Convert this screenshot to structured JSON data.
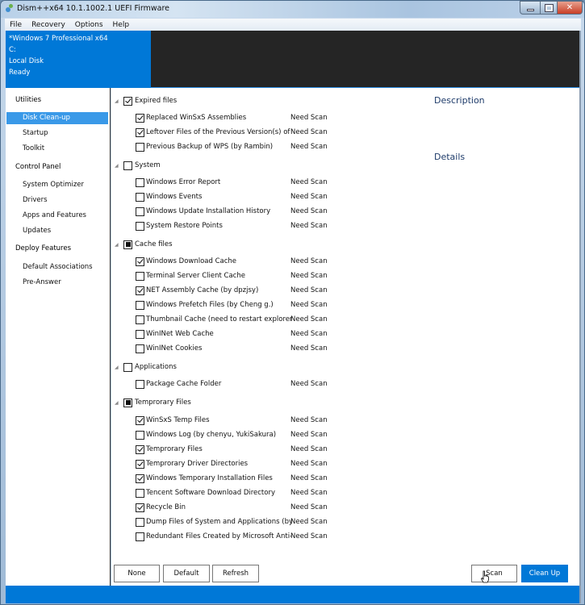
{
  "window": {
    "title": "Dism++x64 10.1.1002.1 UEFI Firmware",
    "controls": {
      "minimize": "minimize",
      "maximize": "maximize",
      "close": "close"
    }
  },
  "menu": [
    "File",
    "Recovery",
    "Options",
    "Help"
  ],
  "info": {
    "os": "*Windows 7 Professional x64",
    "drive": "C:",
    "disk": "Local Disk",
    "status": "Ready"
  },
  "sidebar": {
    "sections": [
      {
        "label": "Utilities",
        "items": [
          {
            "label": "Disk Clean-up",
            "selected": true
          },
          {
            "label": "Startup"
          },
          {
            "label": "Toolkit"
          }
        ]
      },
      {
        "label": "Control Panel",
        "items": [
          {
            "label": "System Optimizer"
          },
          {
            "label": "Drivers"
          },
          {
            "label": "Apps and Features"
          },
          {
            "label": "Updates"
          }
        ]
      },
      {
        "label": "Deploy Features",
        "items": [
          {
            "label": "Default Associations"
          },
          {
            "label": "Pre-Answer"
          }
        ]
      }
    ]
  },
  "tree": [
    {
      "label": "Expired files",
      "state": "checked",
      "items": [
        {
          "label": "Replaced WinSxS Assemblies",
          "checked": true,
          "status": "Need Scan"
        },
        {
          "label": "Leftover Files of the Previous Version(s) of Dism++",
          "checked": true,
          "status": "Need Scan"
        },
        {
          "label": "Previous Backup of WPS (by Rambin)",
          "checked": false,
          "status": "Need Scan"
        }
      ]
    },
    {
      "label": "System",
      "state": "unchecked",
      "items": [
        {
          "label": "Windows Error Report",
          "checked": false,
          "status": "Need Scan"
        },
        {
          "label": "Windows Events",
          "checked": false,
          "status": "Need Scan"
        },
        {
          "label": "Windows Update Installation History",
          "checked": false,
          "status": "Need Scan"
        },
        {
          "label": "System Restore Points",
          "checked": false,
          "status": "Need Scan"
        }
      ]
    },
    {
      "label": "Cache files",
      "state": "partial",
      "items": [
        {
          "label": "Windows Download Cache",
          "checked": true,
          "status": "Need Scan"
        },
        {
          "label": "Terminal Server Client Cache",
          "checked": false,
          "status": "Need Scan"
        },
        {
          "label": "NET Assembly Cache (by dpzjsy)",
          "checked": true,
          "status": "Need Scan"
        },
        {
          "label": "Windows Prefetch Files (by Cheng g.)",
          "checked": false,
          "status": "Need Scan"
        },
        {
          "label": "Thumbnail Cache (need to restart explorer)",
          "checked": false,
          "status": "Need Scan"
        },
        {
          "label": "WinINet Web Cache",
          "checked": false,
          "status": "Need Scan"
        },
        {
          "label": "WinINet Cookies",
          "checked": false,
          "status": "Need Scan"
        }
      ]
    },
    {
      "label": "Applications",
      "state": "unchecked",
      "items": [
        {
          "label": "Package Cache Folder",
          "checked": false,
          "status": "Need Scan"
        }
      ]
    },
    {
      "label": "Temprorary Files",
      "state": "partial",
      "items": [
        {
          "label": "WinSxS Temp Files",
          "checked": true,
          "status": "Need Scan"
        },
        {
          "label": "Windows Log (by chenyu, YukiSakura)",
          "checked": false,
          "status": "Need Scan"
        },
        {
          "label": "Temprorary Files",
          "checked": true,
          "status": "Need Scan"
        },
        {
          "label": "Temprorary Driver Directories",
          "checked": true,
          "status": "Need Scan"
        },
        {
          "label": "Windows Temporary Installation Files",
          "checked": true,
          "status": "Need Scan"
        },
        {
          "label": "Tencent Software Download Directory",
          "checked": false,
          "status": "Need Scan"
        },
        {
          "label": "Recycle Bin",
          "checked": true,
          "status": "Need Scan"
        },
        {
          "label": "Dump Files of System and Applications (by YukiSakura)",
          "checked": false,
          "status": "Need Scan"
        },
        {
          "label": "Redundant Files Created by Microsoft Anti-Malware",
          "checked": false,
          "status": "Need Scan"
        }
      ]
    }
  ],
  "panel": {
    "description": "Description",
    "details": "Details"
  },
  "buttons": {
    "none": "None",
    "default": "Default",
    "refresh": "Refresh",
    "scan": "Scan",
    "cleanup": "Clean Up"
  },
  "colors": {
    "accent": "#0078d7",
    "header_dark": "#252525",
    "heading_text": "#1e3b6a",
    "selected_nav": "#3a99e8"
  }
}
